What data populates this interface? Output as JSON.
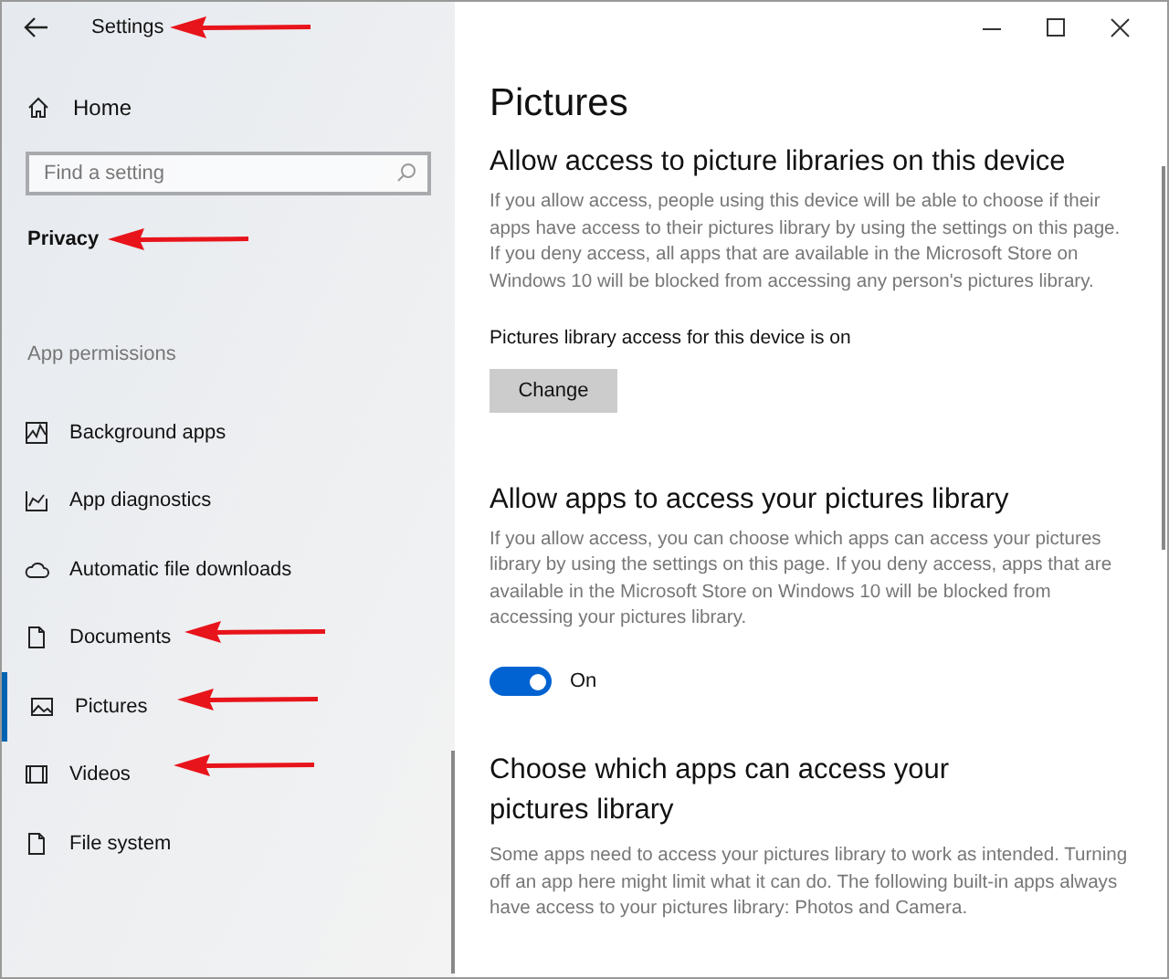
{
  "window": {
    "title": "Settings"
  },
  "sidebar": {
    "home": "Home",
    "search": {
      "placeholder": "Find a setting"
    },
    "category": "Privacy",
    "section": "App permissions",
    "items": [
      {
        "label": "Background apps",
        "kind": "background",
        "selected": false
      },
      {
        "label": "App diagnostics",
        "kind": "diagnostics",
        "selected": false
      },
      {
        "label": "Automatic file downloads",
        "kind": "cloud",
        "selected": false
      },
      {
        "label": "Documents",
        "kind": "document",
        "selected": false
      },
      {
        "label": "Pictures",
        "kind": "picture",
        "selected": true
      },
      {
        "label": "Videos",
        "kind": "video",
        "selected": false
      },
      {
        "label": "File system",
        "kind": "document",
        "selected": false
      }
    ]
  },
  "page": {
    "title": "Pictures",
    "device_section": {
      "heading": "Allow access to picture libraries on this device",
      "description": "If you allow access, people using this device will be able to choose if their apps have access to their pictures library by using the settings on this page. If you deny access, all apps that are available in the Microsoft Store on Windows 10 will be blocked from accessing any person's pictures library.",
      "status": "Pictures library access for this device is on",
      "button": "Change"
    },
    "apps_section": {
      "heading": "Allow apps to access your pictures library",
      "description": "If you allow access, you can choose which apps can access your pictures library by using the settings on this page. If you deny access, apps that are available in the Microsoft Store on Windows 10 will be blocked from accessing your pictures library.",
      "toggle": {
        "on": true,
        "label": "On"
      }
    },
    "choose_section": {
      "heading": "Choose which apps can access your pictures library",
      "description": "Some apps need to access your pictures library to work as intended. Turning off an app here might limit what it can do. The following built-in apps always have access to your pictures library: Photos and Camera."
    }
  }
}
